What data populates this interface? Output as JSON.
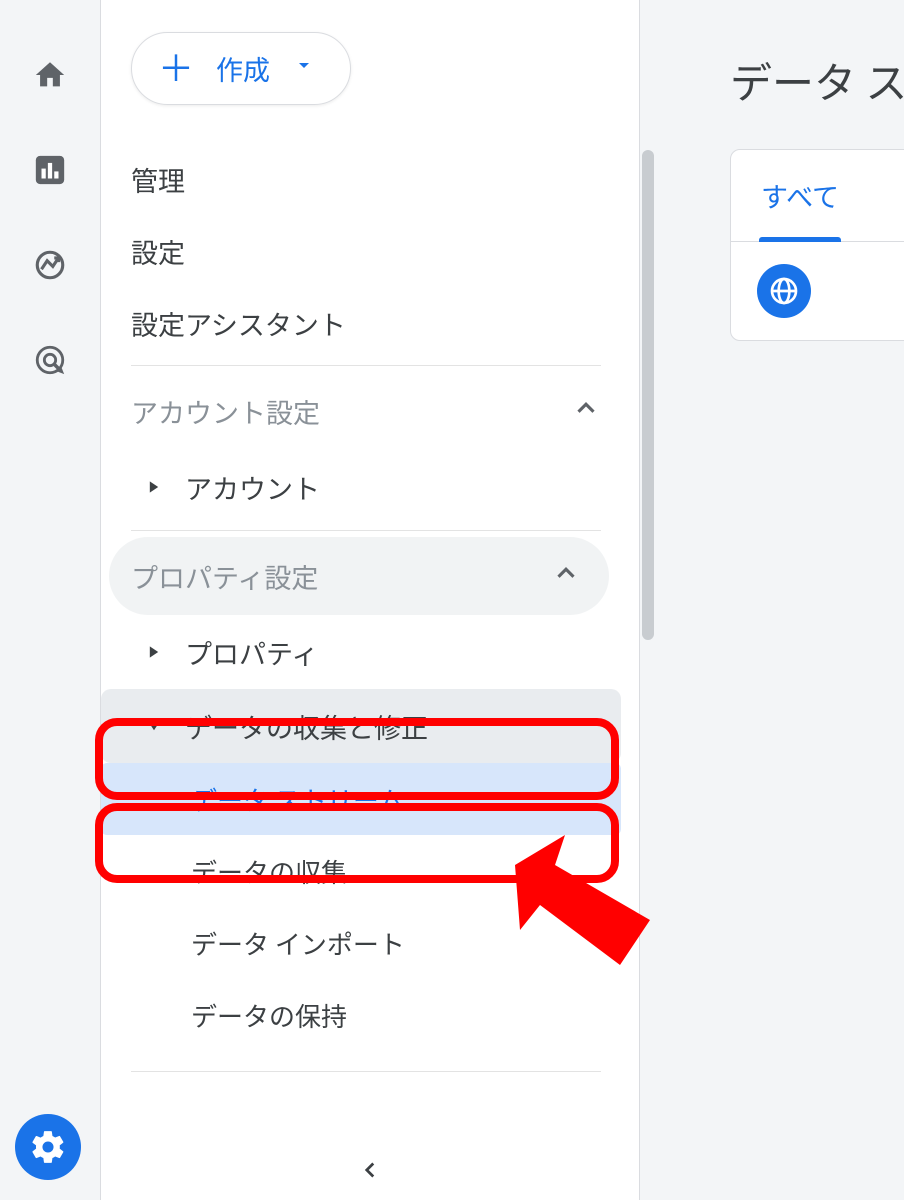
{
  "create_button": {
    "label": "作成"
  },
  "admin": {
    "items": [
      "管理",
      "設定",
      "設定アシスタント"
    ],
    "sections": [
      {
        "label": "アカウント設定",
        "children": [
          "アカウント"
        ]
      },
      {
        "label": "プロパティ設定",
        "children": [
          "プロパティ"
        ],
        "data_group": {
          "label": "データの収集と修正",
          "children": [
            "データ ストリーム",
            "データの収集",
            "データ インポート",
            "データの保持"
          ]
        }
      }
    ]
  },
  "page": {
    "title": "データ ス"
  },
  "tabs": {
    "all": "すべて"
  }
}
